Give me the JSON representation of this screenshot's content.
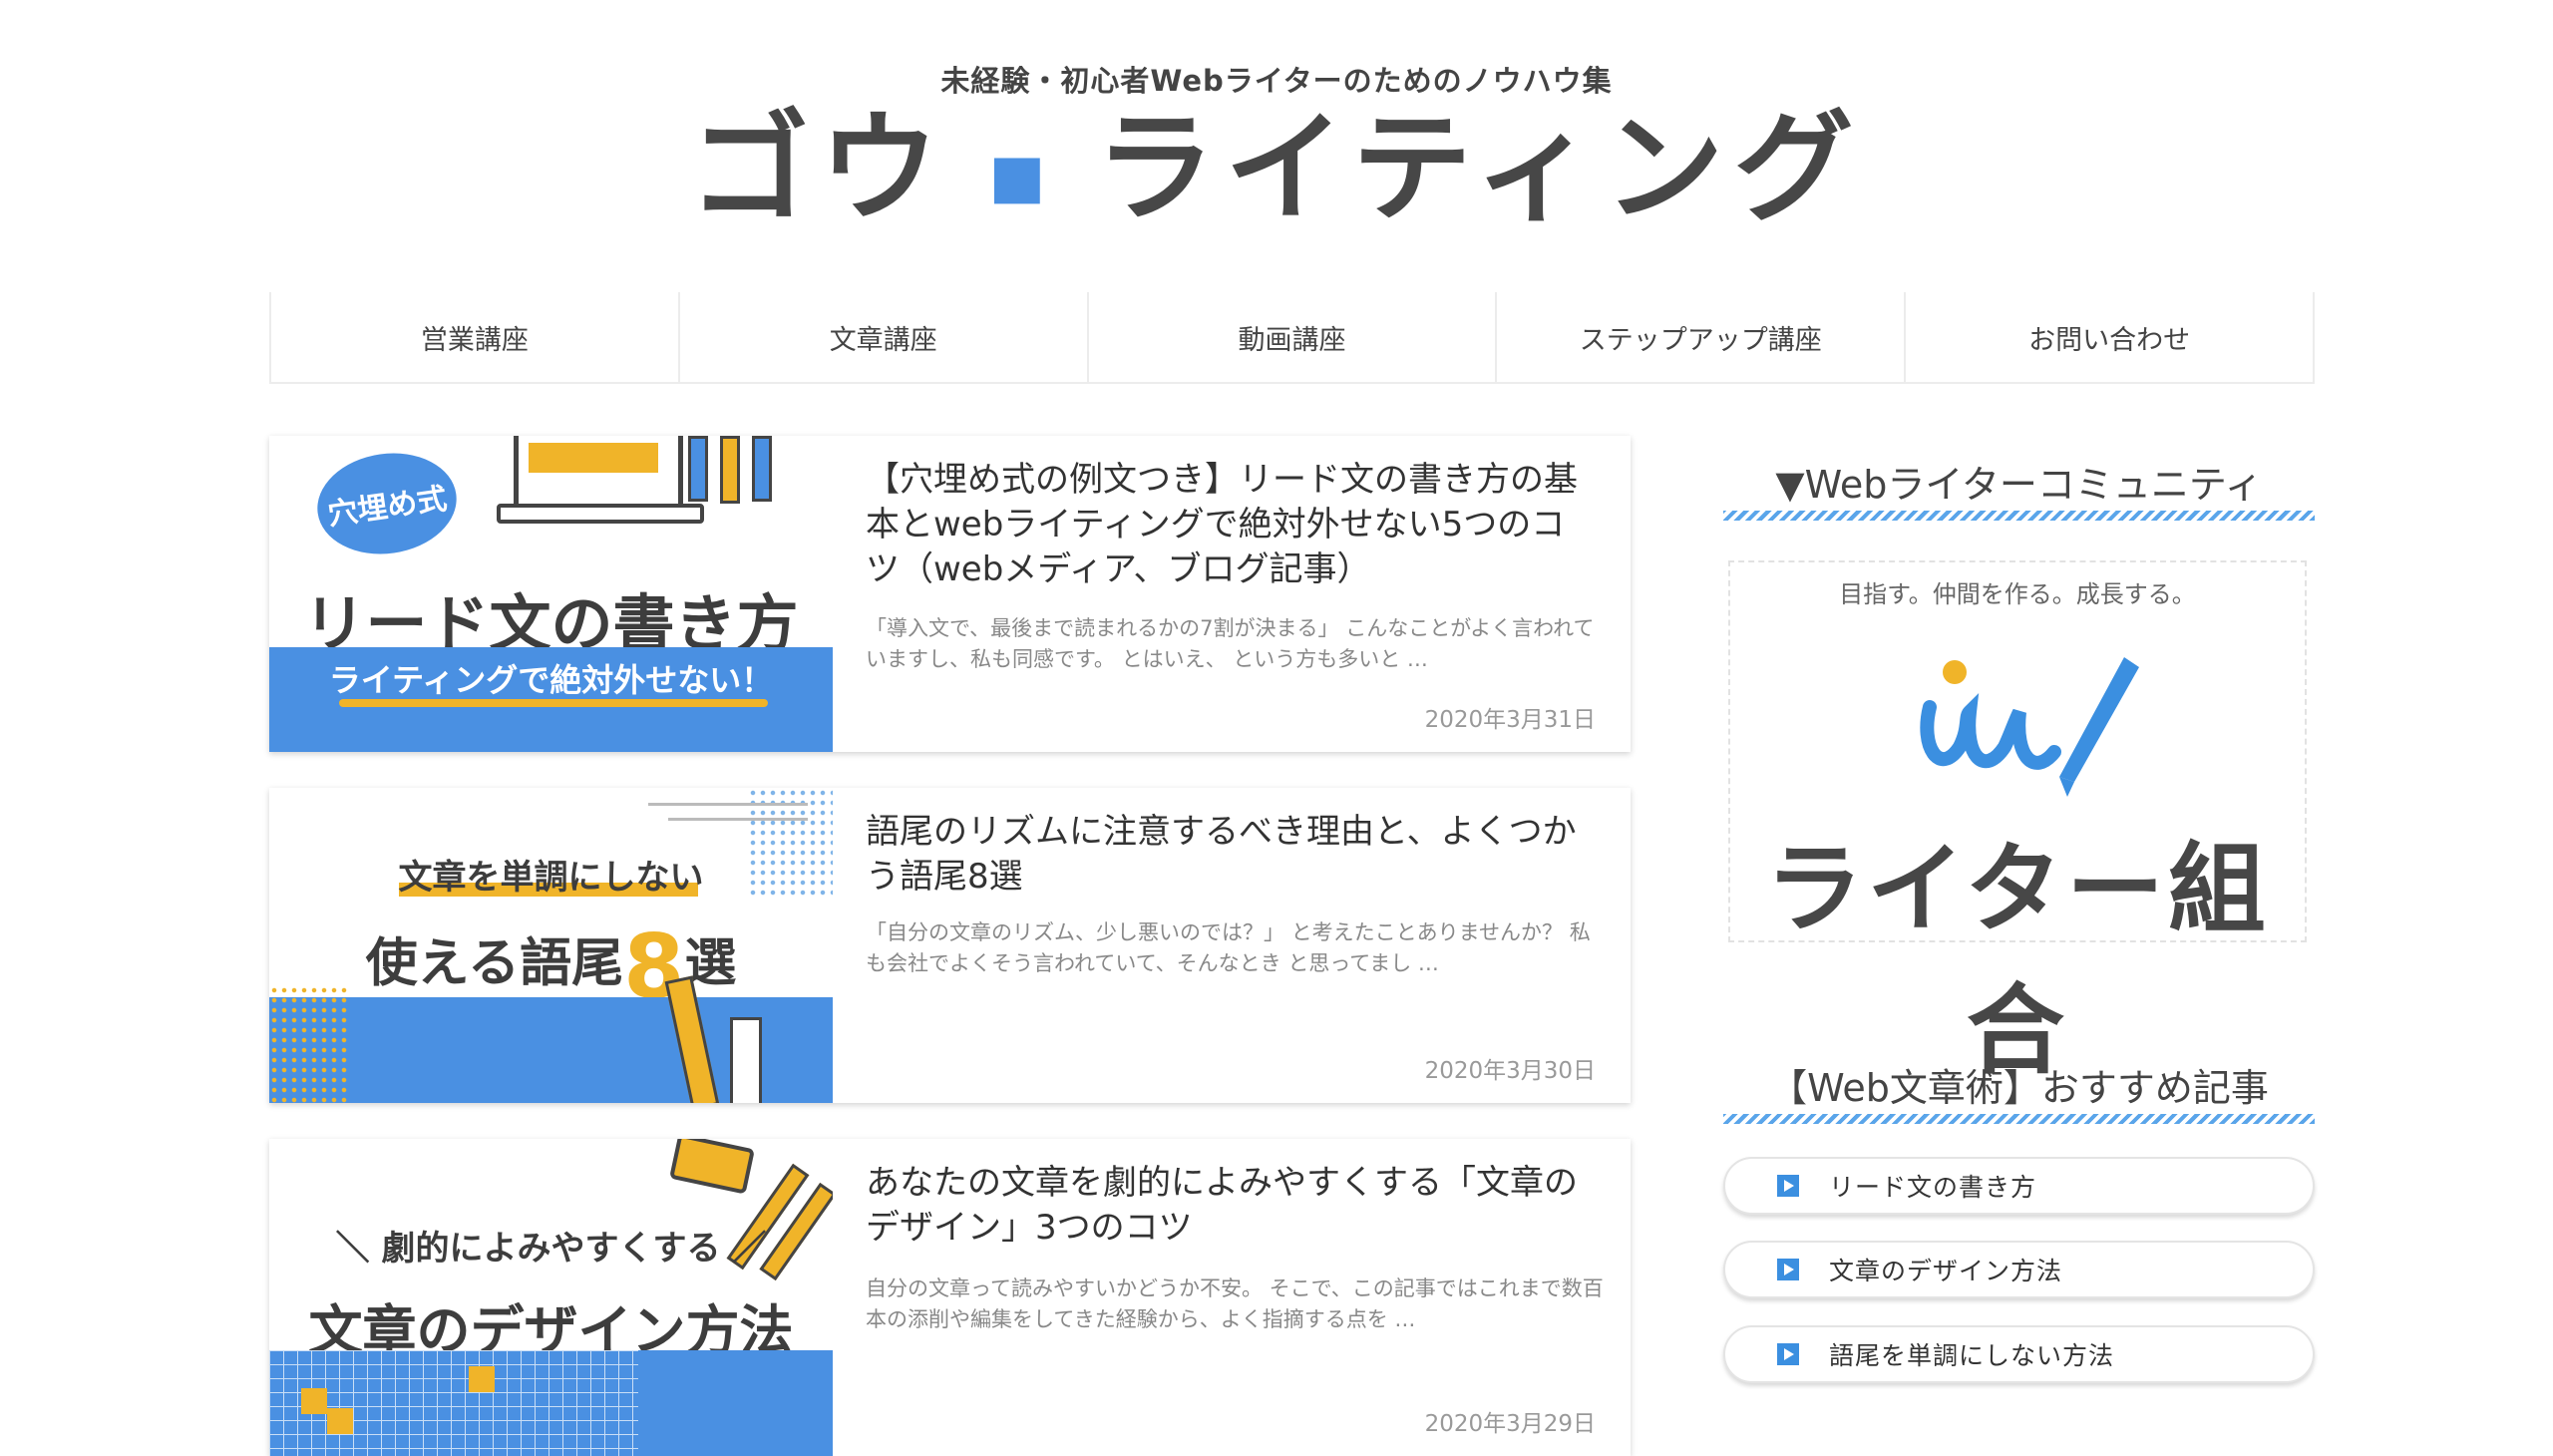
{
  "header": {
    "tagline": "未経験・初心者Webライターのためのノウハウ集",
    "logo_left": "ゴウ",
    "logo_dot": "■",
    "logo_right": "ライティング"
  },
  "nav": {
    "items": [
      {
        "label": "営業講座"
      },
      {
        "label": "文章講座"
      },
      {
        "label": "動画講座"
      },
      {
        "label": "ステップアップ講座"
      },
      {
        "label": "お問い合わせ"
      }
    ]
  },
  "articles": [
    {
      "title": "【穴埋め式の例文つき】リード文の書き方の基本とwebライティングで絶対外せない5つのコツ（webメディア、ブログ記事）",
      "excerpt": "「導入文で、最後まで読まれるかの7割が決まる」 こんなことがよく言われていますし、私も同感です。 とはいえ、 という方も多いと …",
      "date": "2020年3月31日",
      "thumb": {
        "badge": "穴埋め式",
        "main": "リード文の書き方",
        "band": "ライティングで絶対外せない！"
      }
    },
    {
      "title": "語尾のリズムに注意するべき理由と、よくつかう語尾8選",
      "excerpt": "「自分の文章のリズム、少し悪いのでは？」 と考えたことありませんか？ 私も会社でよくそう言われていて、そんなとき と思ってまし …",
      "date": "2020年3月30日",
      "thumb": {
        "sub": "文章を単調にしない",
        "main": "使える語尾",
        "num": "8",
        "suffix": "選"
      }
    },
    {
      "title": "あなたの文章を劇的によみやすくする「文章のデザイン」3つのコツ",
      "excerpt": "自分の文章って読みやすいかどうか不安。 そこで、この記事ではこれまで数百本の添削や編集をしてきた経験から、よく指摘する点を …",
      "date": "2020年3月29日",
      "thumb": {
        "sub": "＼ 劇的によみやすくする ／",
        "main": "文章のデザイン方法"
      }
    }
  ],
  "sidebar": {
    "community_heading": "▼Webライターコミュニティ",
    "banner_sub": "目指す。仲間を作る。成長する。",
    "banner_title": "ライター組合",
    "recommend_heading": "【Web文章術】おすすめ記事",
    "recommend": [
      {
        "label": "リード文の書き方"
      },
      {
        "label": "文章のデザイン方法"
      },
      {
        "label": "語尾を単調にしない方法"
      }
    ]
  },
  "colors": {
    "accent": "#4a90e2",
    "stripe": "#5aa5ea",
    "thumb_yellow": "#f0b429",
    "text": "#333333"
  }
}
